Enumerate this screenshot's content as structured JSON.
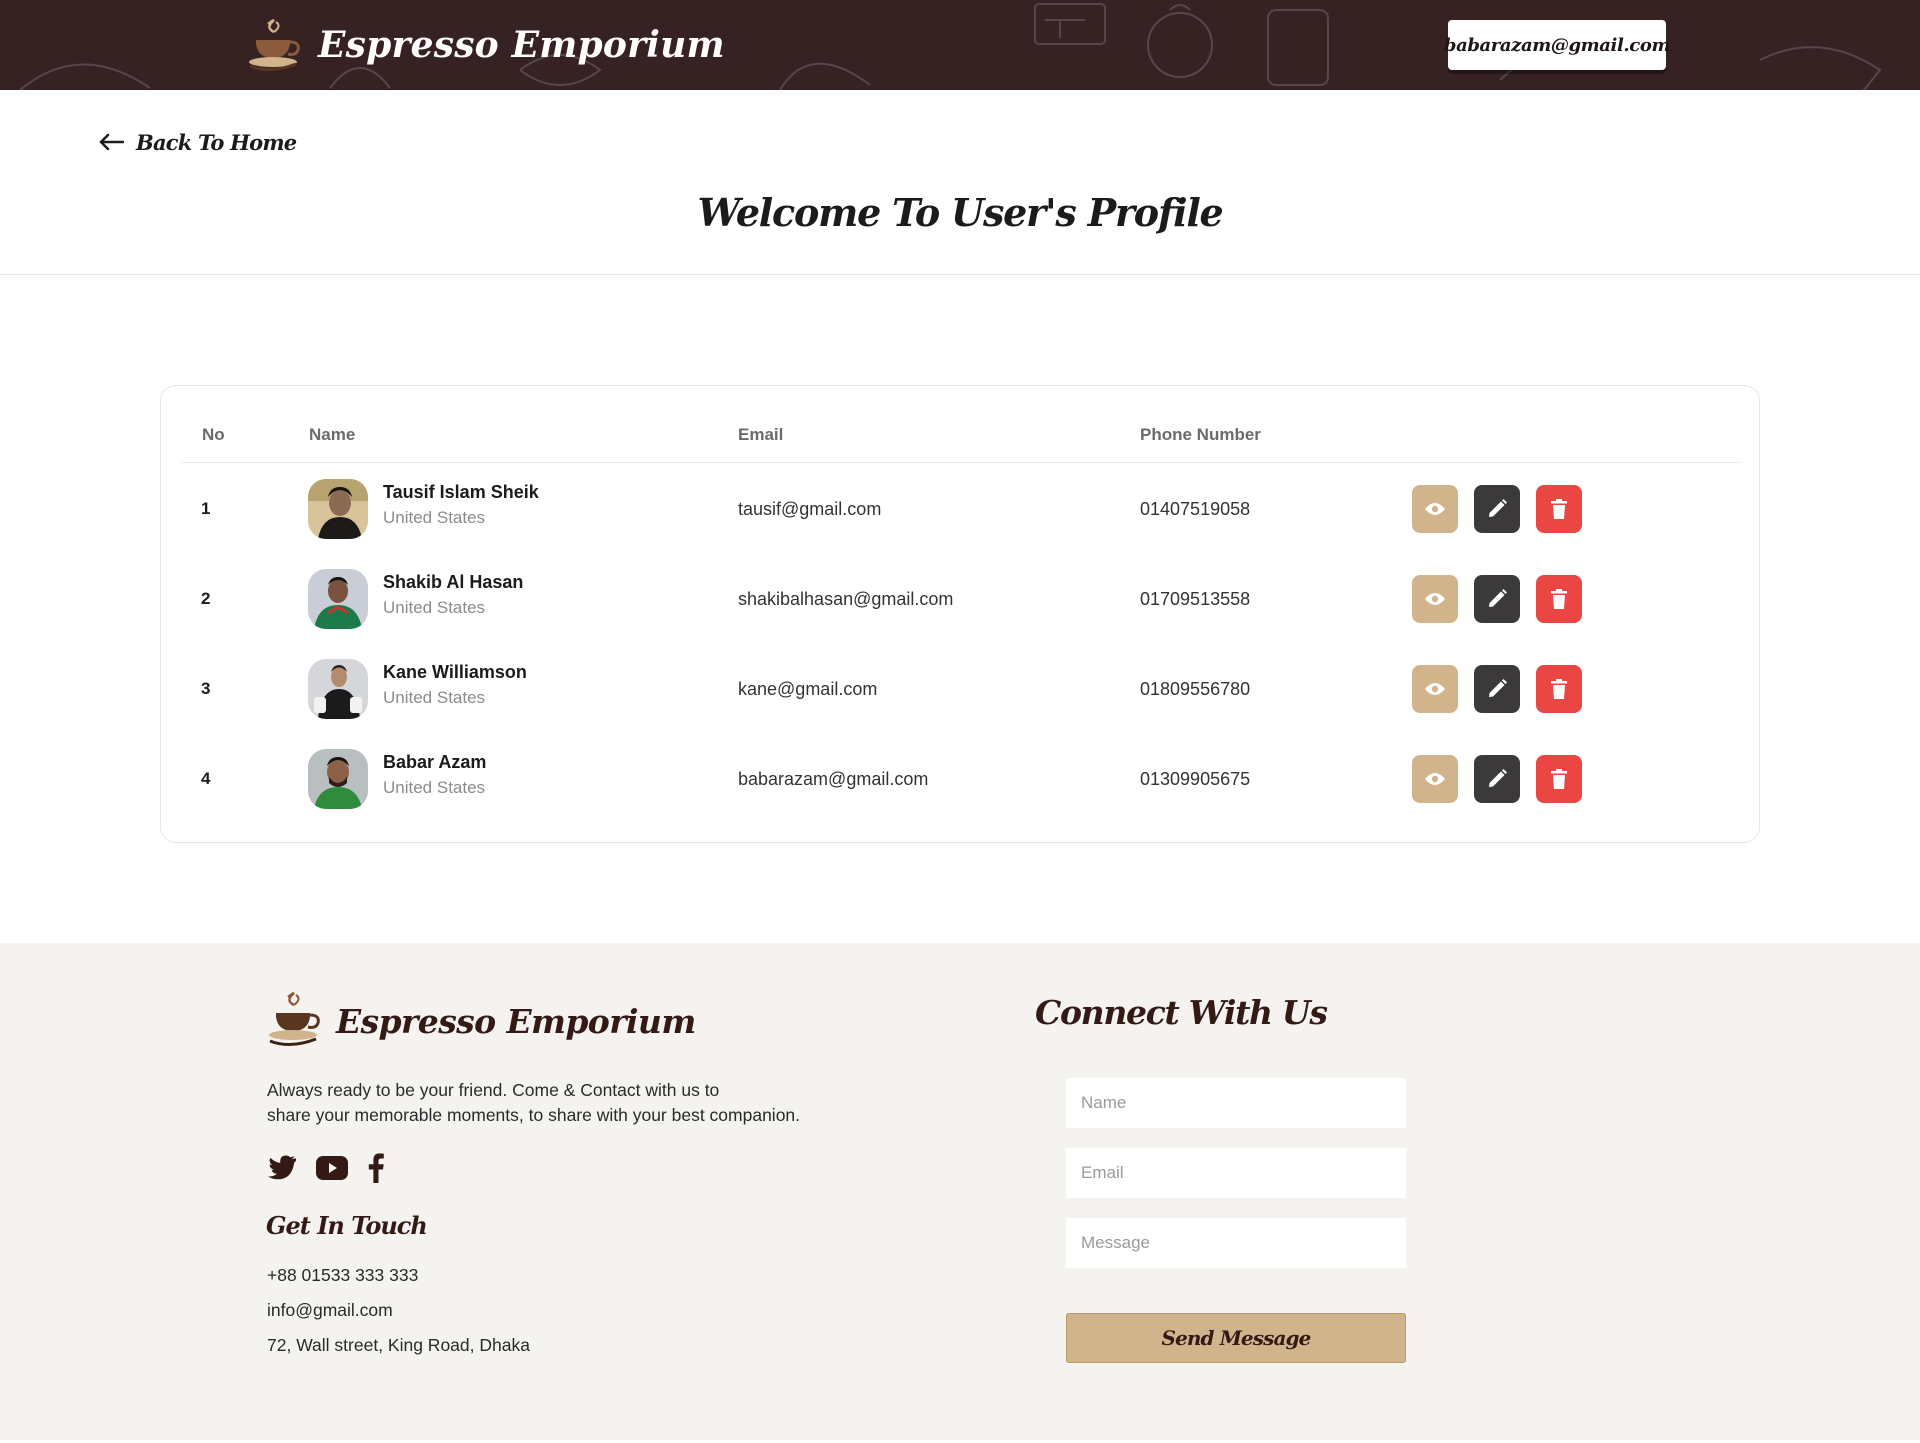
{
  "header": {
    "brand": "Espresso Emporium",
    "user_email": "babarazam@gmail.com"
  },
  "page": {
    "back_label": "Back To Home",
    "title": "Welcome To User's Profile"
  },
  "table": {
    "columns": [
      "No",
      "Name",
      "Email",
      "Phone Number"
    ],
    "rows": [
      {
        "no": "1",
        "name": "Tausif Islam Sheik",
        "country": "United States",
        "email": "tausif@gmail.com",
        "phone": "01407519058"
      },
      {
        "no": "2",
        "name": "Shakib Al Hasan",
        "country": "United States",
        "email": "shakibalhasan@gmail.com",
        "phone": "01709513558"
      },
      {
        "no": "3",
        "name": "Kane Williamson",
        "country": "United States",
        "email": "kane@gmail.com",
        "phone": "01809556780"
      },
      {
        "no": "4",
        "name": "Babar Azam",
        "country": "United States",
        "email": "babarazam@gmail.com",
        "phone": "01309905675"
      }
    ],
    "actions": [
      "eye-icon",
      "pencil-icon",
      "trash-icon"
    ]
  },
  "footer": {
    "brand": "Espresso Emporium",
    "tagline_1": "Always ready to be your friend. Come & Contact with us to",
    "tagline_2": "share your memorable moments, to share with your best companion.",
    "socials": [
      "twitter-icon",
      "youtube-icon",
      "facebook-icon"
    ],
    "get_in_touch": "Get In Touch",
    "phone": "+88 01533 333 333",
    "email": "info@gmail.com",
    "address": "72, Wall street, King Road, Dhaka",
    "connect_title": "Connect With Us",
    "form": {
      "name_placeholder": "Name",
      "email_placeholder": "Email",
      "message_placeholder": "Message",
      "submit_label": "Send Message"
    }
  },
  "colors": {
    "header_bg": "#372223",
    "accent_tan": "#d2b48c",
    "edit_dark": "#3c393b",
    "delete_red": "#ea4744",
    "footer_bg": "#f4f3f0",
    "brand_brown": "#331a15"
  }
}
